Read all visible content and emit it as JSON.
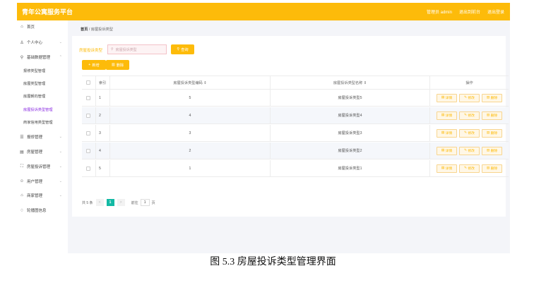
{
  "header": {
    "title": "青年公寓服务平台",
    "admin_text": "管理员 admin",
    "back_text": "退出到前台",
    "logout_text": "退出登录"
  },
  "sidebar": {
    "items": [
      {
        "label": "首页",
        "icon": "home-icon"
      },
      {
        "label": "个人中心",
        "icon": "user-icon"
      },
      {
        "label": "基础数据管理",
        "icon": "location-icon"
      },
      {
        "label": "报修管理",
        "icon": "repair-icon"
      },
      {
        "label": "房屋管理",
        "icon": "house-icon"
      },
      {
        "label": "房屋投诉管理",
        "icon": "complaint-icon"
      },
      {
        "label": "用户管理",
        "icon": "users-icon"
      },
      {
        "label": "商家管理",
        "icon": "shop-icon"
      },
      {
        "label": "轮播图信息",
        "icon": "image-icon"
      }
    ],
    "subitems": [
      {
        "label": "报修类型管理"
      },
      {
        "label": "房屋类型管理"
      },
      {
        "label": "房屋朝向管理"
      },
      {
        "label": "房屋投诉类型管理"
      },
      {
        "label": "商家信用类型管理"
      }
    ]
  },
  "breadcrumb": {
    "home": "首页",
    "sep": "/",
    "current": "房屋投诉类型"
  },
  "search": {
    "label": "房屋投诉类型",
    "placeholder": "房屋投诉类型",
    "button": "查询"
  },
  "actions": {
    "add": "新增",
    "delete": "删除"
  },
  "table": {
    "headers": {
      "index": "索引",
      "code": "房屋投诉类型编码 ⇕",
      "name": "房屋投诉类型名称 ⇕",
      "ops": "操作"
    },
    "rows": [
      {
        "index": "1",
        "code": "5",
        "name": "房屋投诉类型5"
      },
      {
        "index": "2",
        "code": "4",
        "name": "房屋投诉类型4"
      },
      {
        "index": "3",
        "code": "3",
        "name": "房屋投诉类型3"
      },
      {
        "index": "4",
        "code": "2",
        "name": "房屋投诉类型2"
      },
      {
        "index": "5",
        "code": "1",
        "name": "房屋投诉类型1"
      }
    ],
    "op_labels": {
      "detail": "详情",
      "edit": "修改",
      "delete": "删除"
    }
  },
  "pagination": {
    "total": "共 5 条",
    "prev": "<",
    "current": "1",
    "next": ">",
    "goto": "前往",
    "page_value": "1",
    "page_unit": "页"
  },
  "caption": "图 5.3 房屋投诉类型管理界面",
  "colors": {
    "accent": "#fdbb0a",
    "active_menu": "#8a2be2",
    "pager_current": "#13b9a4"
  }
}
